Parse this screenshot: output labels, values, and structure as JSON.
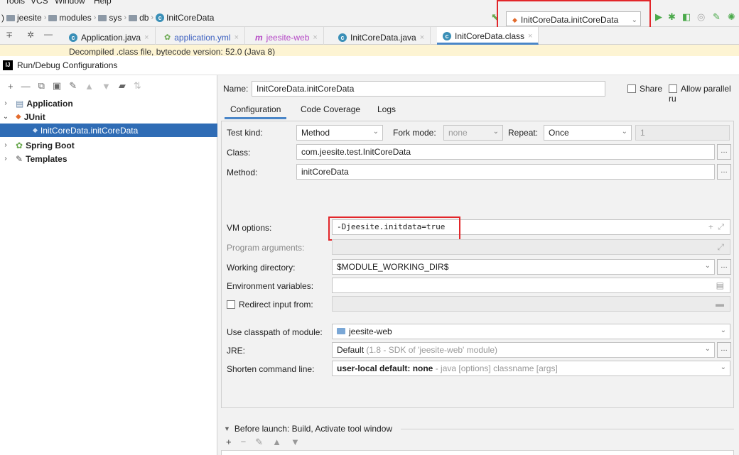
{
  "menubar": {
    "items": [
      "Tools",
      "VCS",
      "Window",
      "Help"
    ]
  },
  "breadcrumb": {
    "leading": ")",
    "items": [
      "jeesite",
      "modules",
      "sys",
      "db",
      "InitCoreData"
    ]
  },
  "run_config": {
    "selected": "InitCoreData.initCoreData"
  },
  "editor_tabs": [
    {
      "label": "Application.java"
    },
    {
      "label": "application.yml"
    },
    {
      "label": "jeesite-web"
    },
    {
      "label": "InitCoreData.java"
    },
    {
      "label": "InitCoreData.class"
    }
  ],
  "decompiled_banner": "Decompiled .class file, bytecode version: 52.0 (Java 8)",
  "dialog": {
    "title": "Run/Debug Configurations",
    "tree": [
      {
        "label": "Application"
      },
      {
        "label": "JUnit"
      },
      {
        "label": "InitCoreData.initCoreData"
      },
      {
        "label": "Spring Boot"
      },
      {
        "label": "Templates"
      }
    ],
    "name_label": "Name:",
    "name_value": "InitCoreData.initCoreData",
    "share_label": "Share",
    "parallel_label": "Allow parallel ru",
    "subtabs": [
      "Configuration",
      "Code Coverage",
      "Logs"
    ],
    "test_kind_label": "Test kind:",
    "test_kind_value": "Method",
    "fork_mode_label": "Fork mode:",
    "fork_mode_value": "none",
    "repeat_label": "Repeat:",
    "repeat_value": "Once",
    "repeat_count": "1",
    "class_label": "Class:",
    "class_value": "com.jeesite.test.InitCoreData",
    "method_label": "Method:",
    "method_value": "initCoreData",
    "vm_label": "VM options:",
    "vm_value": "-Djeesite.initdata=true",
    "program_args_label": "Program arguments:",
    "workdir_label": "Working directory:",
    "workdir_value": "$MODULE_WORKING_DIR$",
    "env_label": "Environment variables:",
    "redirect_label": "Redirect input from:",
    "classpath_label": "Use classpath of module:",
    "classpath_value": "jeesite-web",
    "jre_label": "JRE:",
    "jre_value": "Default",
    "jre_hint": "(1.8 - SDK of 'jeesite-web' module)",
    "shorten_label": "Shorten command line:",
    "shorten_value": "user-local default: none",
    "shorten_hint": "- java [options] classname [args]",
    "before_launch": "Before launch: Build, Activate tool window"
  },
  "colors": {
    "accent": "#2f6cb5",
    "highlight": "#e2262a",
    "banner": "#fdf4d3"
  }
}
